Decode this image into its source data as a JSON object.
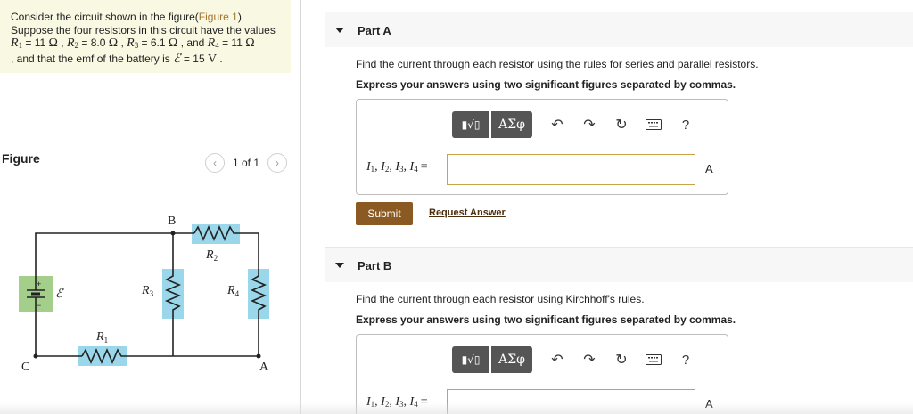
{
  "problem": {
    "line1_prefix": "Consider the circuit shown in the figure(",
    "figure_link": "Figure 1",
    "line1_suffix": ").",
    "line2": "Suppose the four resistors in this circuit have the values",
    "r1_sym": "R",
    "r1_sub": "1",
    "r1_val": " = 11 ",
    "r2_sym": "R",
    "r2_sub": "2",
    "r2_val": " = 8.0 ",
    "r3_sym": "R",
    "r3_sub": "3",
    "r3_val": " = 6.1 ",
    "r4_sym": "R",
    "r4_sub": "4",
    "r4_val": " = 11 ",
    "ohm": "Ω",
    "sep": " , ",
    "and": " , and ",
    "line4_prefix": ", and that the emf of the battery is ",
    "emf_sym": "ℰ",
    "emf_val": " = 15 ",
    "emf_unit": "V",
    "end": " ."
  },
  "figure": {
    "label": "Figure",
    "pager_text": "1 of 1",
    "prev_icon": "‹",
    "next_icon": "›",
    "labels": {
      "B": "B",
      "C": "C",
      "A": "A",
      "R": "R",
      "sub1": "1",
      "sub2": "2",
      "sub3": "3",
      "sub4": "4",
      "emf": "ℰ",
      "plus": "+",
      "minus": "−"
    },
    "colors": {
      "resistor_highlight": "#9bd7ea",
      "battery_highlight": "#a3cf8b",
      "wire": "#222222"
    }
  },
  "partA": {
    "title": "Part A",
    "prompt": "Find the current through each resistor using the rules for series and parallel resistors.",
    "instruction": "Express your answers using two significant figures separated by commas.",
    "var_I": "I",
    "subs": [
      "1",
      "2",
      "3",
      "4"
    ],
    "comma": ", ",
    "equals": "=",
    "unit": "A",
    "input_value": "",
    "submit": "Submit",
    "request_answer": "Request Answer"
  },
  "partB": {
    "title": "Part B",
    "prompt": "Find the current through each resistor using Kirchhoff's rules.",
    "instruction": "Express your answers using two significant figures separated by commas.",
    "var_I": "I",
    "subs": [
      "1",
      "2",
      "3",
      "4"
    ],
    "comma": ", ",
    "equals": "=",
    "unit": "A",
    "input_value": ""
  },
  "toolbar": {
    "template_icon": "▮√▯",
    "greek_label": "ΑΣφ",
    "undo_icon": "↶",
    "redo_icon": "↷",
    "reset_icon": "↻",
    "keyboard_icon": "keyboard-icon",
    "help_label": "?"
  },
  "colors": {
    "accent_brown": "#8b5a22",
    "input_border": "#c9a24a",
    "problem_bg": "#f8f8e3"
  }
}
